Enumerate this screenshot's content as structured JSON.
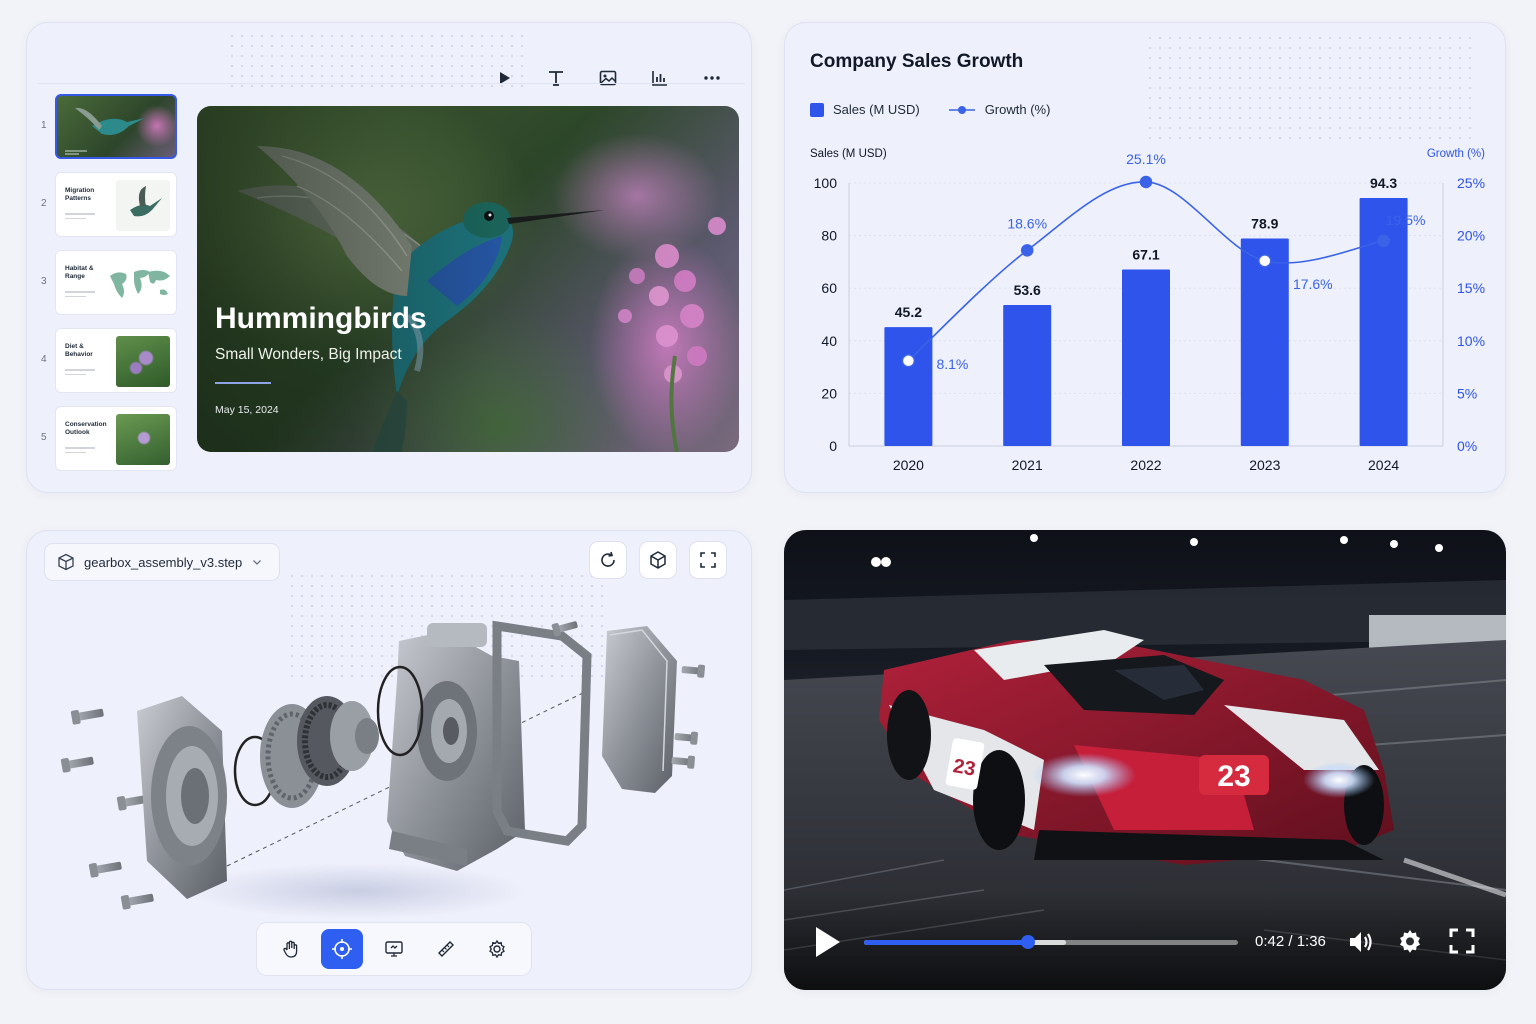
{
  "slides": {
    "toolbar": [
      "play-icon",
      "text-icon",
      "image-icon",
      "chart-icon",
      "more-icon"
    ],
    "thumbnails": [
      {
        "num": "1",
        "title": "",
        "active": true
      },
      {
        "num": "2",
        "title": "Migration Patterns",
        "active": false
      },
      {
        "num": "3",
        "title": "Habitat & Range",
        "active": false
      },
      {
        "num": "4",
        "title": "Diet & Behavior",
        "active": false
      },
      {
        "num": "5",
        "title": "Conservation Outlook",
        "active": false
      }
    ],
    "main": {
      "title": "Hummingbirds",
      "subtitle": "Small Wonders, Big Impact",
      "date": "May 15, 2024"
    }
  },
  "chart": {
    "title": "Company Sales Growth",
    "legend_sales": "Sales (M USD)",
    "legend_growth": "Growth (%)"
  },
  "chart_data": {
    "type": "bar",
    "title": "Company Sales Growth",
    "categories": [
      "2020",
      "2021",
      "2022",
      "2023",
      "2024"
    ],
    "series": [
      {
        "name": "Sales (M USD)",
        "type": "bar",
        "axis": "left",
        "values": [
          45.2,
          53.6,
          67.1,
          78.9,
          94.3
        ],
        "labels": [
          "45.2",
          "53.6",
          "67.1",
          "78.9",
          "94.3"
        ]
      },
      {
        "name": "Growth (%)",
        "type": "line",
        "axis": "right",
        "values": [
          8.1,
          18.6,
          25.1,
          17.6,
          19.5
        ],
        "labels": [
          "8.1%",
          "18.6%",
          "25.1%",
          "17.6%",
          "19.5%"
        ]
      }
    ],
    "ylabel": "Sales (M USD)",
    "y2label": "Growth (%)",
    "ylim": [
      0,
      100
    ],
    "y2lim": [
      0,
      25
    ],
    "yticks": [
      "0",
      "20",
      "40",
      "60",
      "80",
      "100"
    ],
    "y2ticks": [
      "0%",
      "5%",
      "10%",
      "15%",
      "20%",
      "25%"
    ],
    "grid": true,
    "legend": "top-left",
    "colors": {
      "bar": "#2f54eb",
      "line": "#3a63e8"
    }
  },
  "cad": {
    "filename": "gearbox_assembly_v3.step",
    "top_buttons": [
      "refresh-icon",
      "cube-icon",
      "fullscreen-icon"
    ],
    "tools": [
      {
        "icon": "hand-icon",
        "active": false
      },
      {
        "icon": "crosshair-icon",
        "active": true
      },
      {
        "icon": "presentation-icon",
        "active": false
      },
      {
        "icon": "ruler-icon",
        "active": false
      },
      {
        "icon": "settings-icon",
        "active": false
      }
    ]
  },
  "video": {
    "time": "0:42 / 1:36",
    "progress": 0.4375,
    "buffered": 0.54,
    "car_number": "23",
    "accent": "#2f5ff0"
  }
}
